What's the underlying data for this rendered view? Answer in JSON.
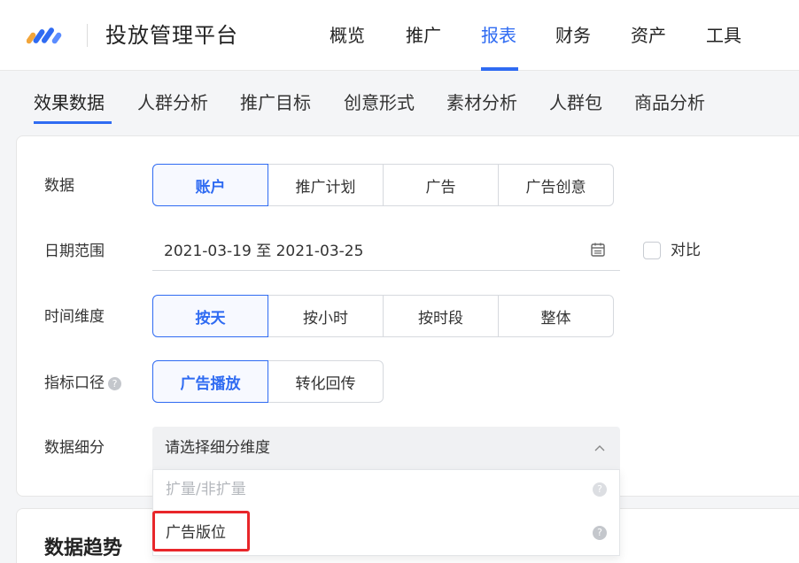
{
  "header": {
    "app_title": "投放管理平台",
    "logo_icon": "brand-logo-icon",
    "nav": [
      {
        "label": "概览"
      },
      {
        "label": "推广"
      },
      {
        "label": "报表",
        "active": true
      },
      {
        "label": "财务"
      },
      {
        "label": "资产"
      },
      {
        "label": "工具"
      }
    ]
  },
  "subtabs": [
    {
      "label": "效果数据",
      "active": true
    },
    {
      "label": "人群分析"
    },
    {
      "label": "推广目标"
    },
    {
      "label": "创意形式"
    },
    {
      "label": "素材分析"
    },
    {
      "label": "人群包"
    },
    {
      "label": "商品分析"
    }
  ],
  "filters": {
    "data": {
      "label": "数据",
      "options": [
        "账户",
        "推广计划",
        "广告",
        "广告创意"
      ],
      "selected": "账户"
    },
    "date_range": {
      "label": "日期范围",
      "value": "2021-03-19 至 2021-03-25",
      "compare_label": "对比",
      "compare_checked": false
    },
    "time_dimension": {
      "label": "时间维度",
      "options": [
        "按天",
        "按小时",
        "按时段",
        "整体"
      ],
      "selected": "按天"
    },
    "metric_caliber": {
      "label": "指标口径",
      "help": "?",
      "options": [
        "广告播放",
        "转化回传"
      ],
      "selected": "广告播放"
    },
    "breakdown": {
      "label": "数据细分",
      "placeholder": "请选择细分维度",
      "dropdown": [
        {
          "label": "扩量/非扩量",
          "disabled": true,
          "help": "?"
        },
        {
          "label": "广告版位",
          "disabled": false,
          "help": "?"
        }
      ]
    }
  },
  "trend": {
    "title": "数据趋势"
  },
  "colors": {
    "accent": "#2f6bf2",
    "highlight": "#e8262a"
  }
}
